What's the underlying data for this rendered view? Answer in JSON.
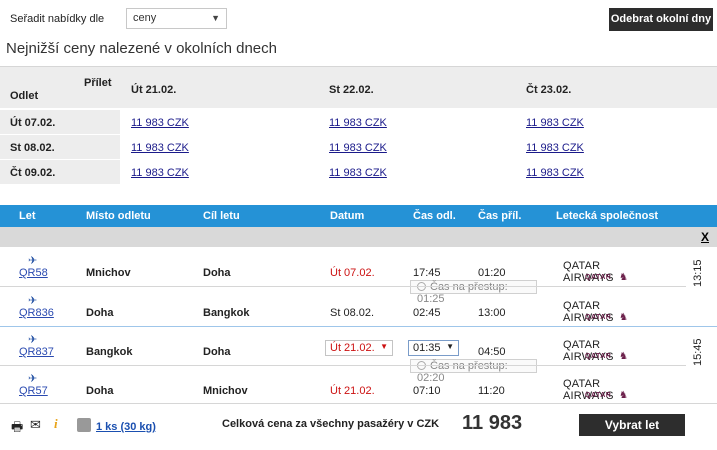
{
  "sort": {
    "label": "Seřadit nabídky dle",
    "value": "ceny"
  },
  "remove_nearby_label": "Odebrat okolní dny",
  "nearby_title": "Nejnižší ceny nalezené v okolních dnech",
  "matrix": {
    "arrival_label": "Přílet",
    "departure_label": "Odlet",
    "columns": [
      "Út 21.02.",
      "St 22.02.",
      "Čt 23.02."
    ],
    "rows": [
      {
        "label": "Út 07.02.",
        "prices": [
          "11 983 CZK",
          "11 983 CZK",
          "11 983 CZK"
        ]
      },
      {
        "label": "St 08.02.",
        "prices": [
          "11 983 CZK",
          "11 983 CZK",
          "11 983 CZK"
        ]
      },
      {
        "label": "Čt 09.02.",
        "prices": [
          "11 983 CZK",
          "11 983 CZK",
          "11 983 CZK"
        ]
      }
    ]
  },
  "flights_header": {
    "flight": "Let",
    "from": "Místo odletu",
    "to": "Cíl letu",
    "date": "Datum",
    "dep": "Čas odl.",
    "arr": "Čas příl.",
    "airline": "Letecká společnost"
  },
  "close_label": "X",
  "flights": [
    {
      "no": "QR58",
      "from": "Mnichov",
      "to": "Doha",
      "date": "Út 07.02.",
      "dep": "17:45",
      "arr": "01:20",
      "airline": "QATAR AIRWAYS",
      "logo": "QATAR"
    },
    {
      "no": "QR836",
      "from": "Doha",
      "to": "Bangkok",
      "date": "St 08.02.",
      "dep": "02:45",
      "arr": "13:00",
      "airline": "QATAR AIRWAYS",
      "logo": "QATAR"
    },
    {
      "no": "QR837",
      "from": "Bangkok",
      "to": "Doha",
      "date": "Út 21.02.",
      "dep": "01:35",
      "arr": "04:50",
      "airline": "QATAR AIRWAYS",
      "logo": "QATAR"
    },
    {
      "no": "QR57",
      "from": "Doha",
      "to": "Mnichov",
      "date": "Út 21.02.",
      "dep": "07:10",
      "arr": "11:20",
      "airline": "QATAR AIRWAYS",
      "logo": "QATAR"
    }
  ],
  "transfers": [
    "Čas na přestup: 01:25",
    "Čas na přestup: 02:20"
  ],
  "durations": [
    "13:15",
    "15:45"
  ],
  "footer": {
    "baggage_link": "1 ks (30 kg)",
    "total_label": "Celková cena za všechny pasažéry v CZK",
    "total_value": "11 983",
    "select_label": "Vybrat let"
  },
  "icons": [
    "plane-icon",
    "printer-icon",
    "mail-icon",
    "info-icon",
    "luggage-icon",
    "clock-icon"
  ],
  "colors": {
    "header_blue": "#2592d6",
    "dark_button": "#2d2d2d",
    "red_date": "#cc1111",
    "qatar_maroon": "#6b1f4a"
  }
}
